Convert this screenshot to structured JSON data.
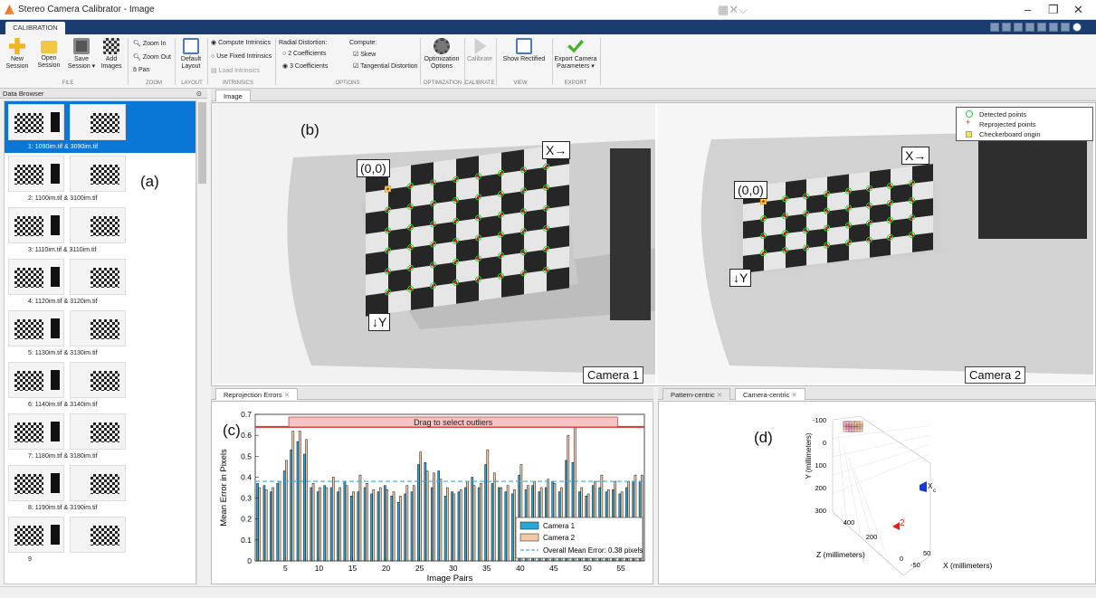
{
  "window": {
    "title": "Stereo Camera Calibrator - Image",
    "minimize": "–",
    "restore": "❐",
    "close": "✕"
  },
  "ribbon_tab": "CALIBRATION",
  "ribbon": {
    "file": {
      "new_session": [
        "New",
        "Session"
      ],
      "open_session": [
        "Open",
        "Session"
      ],
      "save_session": [
        "Save",
        "Session ▾"
      ],
      "add_images": [
        "Add",
        "Images"
      ],
      "section": "FILE"
    },
    "zoom": {
      "zoom_in": "Zoom In",
      "zoom_out": "Zoom Out",
      "pan": "Pan",
      "section": "ZOOM"
    },
    "layout": {
      "default_layout": [
        "Default",
        "Layout"
      ],
      "section": "LAYOUT"
    },
    "intrinsics": {
      "compute": "Compute Intrinsics",
      "use_fixed": "Use Fixed Intrinsics",
      "load": "Load Intrinsics",
      "section": "INTRINSICS"
    },
    "options": {
      "radial_label": "Radial Distortion:",
      "coef2": "2 Coefficients",
      "coef3": "3 Coefficients",
      "compute_label": "Compute:",
      "skew": "Skew",
      "tangential": "Tangential Distortion",
      "section": "OPTIONS"
    },
    "optimization": {
      "label": [
        "Optimization",
        "Options"
      ],
      "section": "OPTIMIZATION"
    },
    "calibrate": {
      "label": "Calibrate",
      "section": "CALIBRATE"
    },
    "view": {
      "label": "Show Rectified",
      "section": "VIEW"
    },
    "export": {
      "label": [
        "Export Camera",
        "Parameters ▾"
      ],
      "section": "EXPORT"
    }
  },
  "data_browser": {
    "title": "Data Browser",
    "items": [
      "1: 1090im.tif & 3090im.tif",
      "2: 1100im.tif & 3100im.tif",
      "3: 1110im.tif & 3110im.tif",
      "4: 1120im.tif & 3120im.tif",
      "5: 1130im.tif & 3130im.tif",
      "6: 1140im.tif & 3140im.tif",
      "7: 1180im.tif & 3180im.tif",
      "8: 1190im.tif & 3190im.tif",
      "9"
    ],
    "selected_index": 0
  },
  "image_panel": {
    "tab": "Image",
    "origin": "(0,0)",
    "x_axis": "X→",
    "y_axis": "↓Y",
    "camera1": "Camera 1",
    "camera2": "Camera 2",
    "legend": [
      "Detected points",
      "Reprojected points",
      "Checkerboard origin"
    ]
  },
  "annotations": {
    "a": "(a)",
    "b": "(b)",
    "c": "(c)",
    "d": "(d)"
  },
  "reprojection_tab": "Reprojection Errors",
  "extrinsics_tabs": [
    "Pattern-centric",
    "Camera-centric"
  ],
  "colors": {
    "camera1_bar": "#2aa6d8",
    "camera2_bar": "#f2c9a6",
    "mean_line": "#4aa3d8",
    "selection_line": "#e03030",
    "selected_row": "#0a76d6"
  },
  "chart_data": [
    {
      "type": "bar",
      "title": "",
      "xlabel": "Image Pairs",
      "ylabel": "Mean Error in Pixels",
      "ylim": [
        0,
        0.7
      ],
      "xlim": [
        0.5,
        58.5
      ],
      "yticks": [
        "0",
        "0.1",
        "0.2",
        "0.3",
        "0.4",
        "0.5",
        "0.6",
        "0.7"
      ],
      "xticks": [
        "5",
        "10",
        "15",
        "20",
        "25",
        "30",
        "35",
        "40",
        "45",
        "50",
        "55"
      ],
      "xtick_values": [
        5,
        10,
        15,
        20,
        25,
        30,
        35,
        40,
        45,
        50,
        55
      ],
      "grid": false,
      "legend_position": "bottom-right",
      "series": [
        {
          "name": "Camera 1",
          "values": [
            0.37,
            0.36,
            0.33,
            0.37,
            0.43,
            0.53,
            0.57,
            0.51,
            0.35,
            0.33,
            0.36,
            0.35,
            0.33,
            0.38,
            0.31,
            0.33,
            0.35,
            0.32,
            0.33,
            0.36,
            0.31,
            0.28,
            0.32,
            0.33,
            0.46,
            0.47,
            0.35,
            0.43,
            0.31,
            0.33,
            0.33,
            0.35,
            0.4,
            0.35,
            0.46,
            0.37,
            0.35,
            0.33,
            0.32,
            0.41,
            0.34,
            0.36,
            0.33,
            0.35,
            0.38,
            0.33,
            0.48,
            0.47,
            0.33,
            0.31,
            0.36,
            0.35,
            0.33,
            0.34,
            0.32,
            0.35,
            0.38,
            0.38
          ]
        },
        {
          "name": "Camera 2",
          "values": [
            0.35,
            0.34,
            0.35,
            0.38,
            0.48,
            0.62,
            0.62,
            0.58,
            0.37,
            0.35,
            0.35,
            0.4,
            0.35,
            0.36,
            0.33,
            0.41,
            0.37,
            0.34,
            0.35,
            0.34,
            0.33,
            0.31,
            0.36,
            0.36,
            0.52,
            0.43,
            0.42,
            0.39,
            0.35,
            0.32,
            0.34,
            0.38,
            0.36,
            0.37,
            0.53,
            0.42,
            0.35,
            0.36,
            0.34,
            0.46,
            0.36,
            0.38,
            0.35,
            0.39,
            0.37,
            0.35,
            0.6,
            0.64,
            0.35,
            0.32,
            0.38,
            0.41,
            0.34,
            0.38,
            0.33,
            0.38,
            0.41,
            0.41
          ]
        }
      ],
      "mean_error": 0.38,
      "selection_threshold": 0.64,
      "drag_label": "Drag to select outliers",
      "legend_mean_label": "Overall Mean Error: 0.38 pixels"
    },
    {
      "type": "scatter",
      "title": "",
      "xlabel": "X (millimeters)",
      "ylabel": "Y (millimeters)",
      "zlabel": "Z (millimeters)",
      "y_ticks": [
        "-100",
        "0",
        "100",
        "200",
        "300"
      ],
      "z_ticks": [
        "400",
        "200",
        "0"
      ],
      "x_ticks": [
        "-50",
        "50"
      ],
      "camera_label": "X",
      "camera_sub": "c",
      "pattern_label": "2",
      "grid": true
    }
  ]
}
